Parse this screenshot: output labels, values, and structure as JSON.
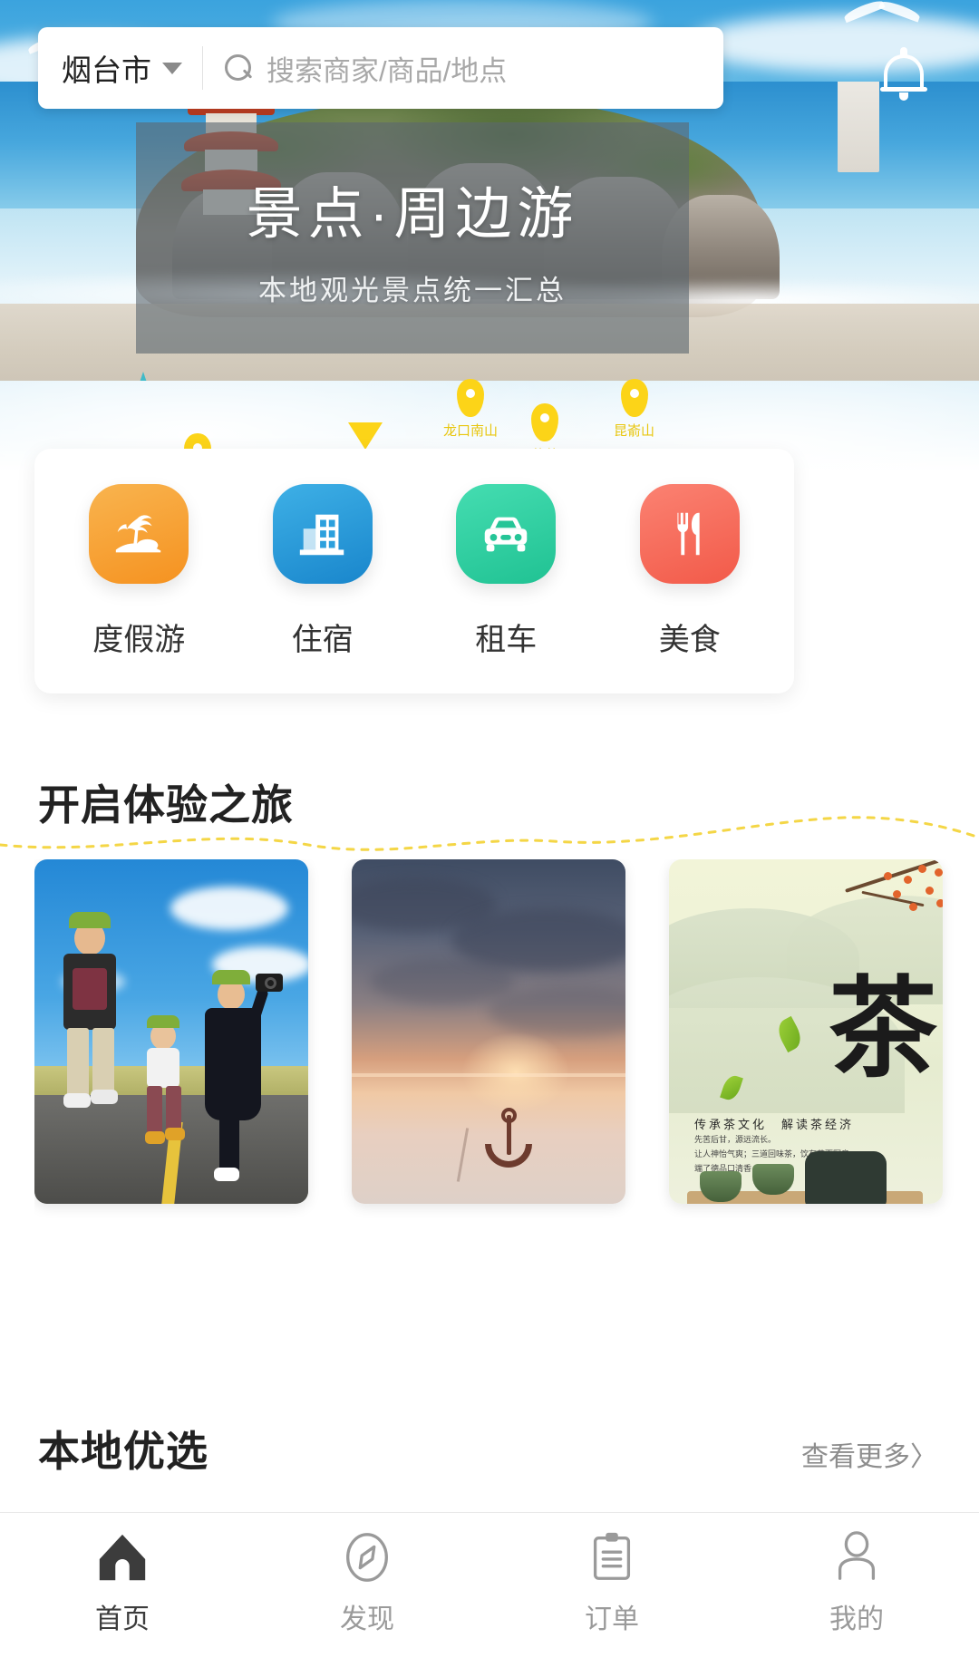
{
  "header": {
    "city": "烟台市",
    "city_caret_icon": "chevron-down-icon",
    "search_icon": "search-icon",
    "search_placeholder": "搜索商家/商品/地点",
    "search_value": "",
    "bell_icon": "bell-icon"
  },
  "banner": {
    "title": "景点·周边游",
    "subtitle": "本地观光景点统一汇总"
  },
  "map_pins": [
    {
      "label": "",
      "name": "map-pin-left"
    },
    {
      "label": "",
      "name": "map-pin-arrow"
    },
    {
      "label": "龙口南山",
      "name": "map-pin-longkou-nanshan"
    },
    {
      "label": "蓬莱",
      "name": "map-pin-penglai"
    },
    {
      "label": "昆嵛山",
      "name": "map-pin-kunyushan"
    }
  ],
  "categories": [
    {
      "label": "度假游",
      "icon": "palm-island-icon",
      "color": "#f7a83c",
      "color2": "#f79a2a"
    },
    {
      "label": "住宿",
      "icon": "building-icon",
      "color": "#2ca5e0",
      "color2": "#1d8fd1"
    },
    {
      "label": "租车",
      "icon": "car-icon",
      "color": "#2fd3a5",
      "color2": "#22c596"
    },
    {
      "label": "美食",
      "icon": "fork-knife-icon",
      "color": "#f8705f",
      "color2": "#f4604f"
    }
  ],
  "experience_section": {
    "title": "开启体验之旅",
    "cards": [
      {
        "name": "card-jumping-family",
        "alt": "户外跳跃合影"
      },
      {
        "name": "card-anchor-sunset",
        "alt": "日落海滩船锚"
      },
      {
        "name": "card-tea-poster",
        "alt": "茶文化海报",
        "poster_head": "传承茶文化　解读茶经济",
        "poster_lines": [
          "先苦后甘，源远流长。",
          "让人神怡气爽；三道回味茶，饮有花而写意。",
          "端了德品口清香，回味无穷"
        ],
        "big_char": "茶"
      }
    ]
  },
  "local_section": {
    "title": "本地优选",
    "more": "查看更多〉"
  },
  "tabbar": [
    {
      "label": "首页",
      "icon": "home-icon",
      "active": true
    },
    {
      "label": "发现",
      "icon": "compass-icon",
      "active": false
    },
    {
      "label": "订单",
      "icon": "clipboard-icon",
      "active": false
    },
    {
      "label": "我的",
      "icon": "person-icon",
      "active": false
    }
  ],
  "colors": {
    "accent_yellow": "#fcd418",
    "active_tab": "#3c3c3c",
    "inactive_tab": "#9a9a9a",
    "sky": "#3ba3de"
  }
}
